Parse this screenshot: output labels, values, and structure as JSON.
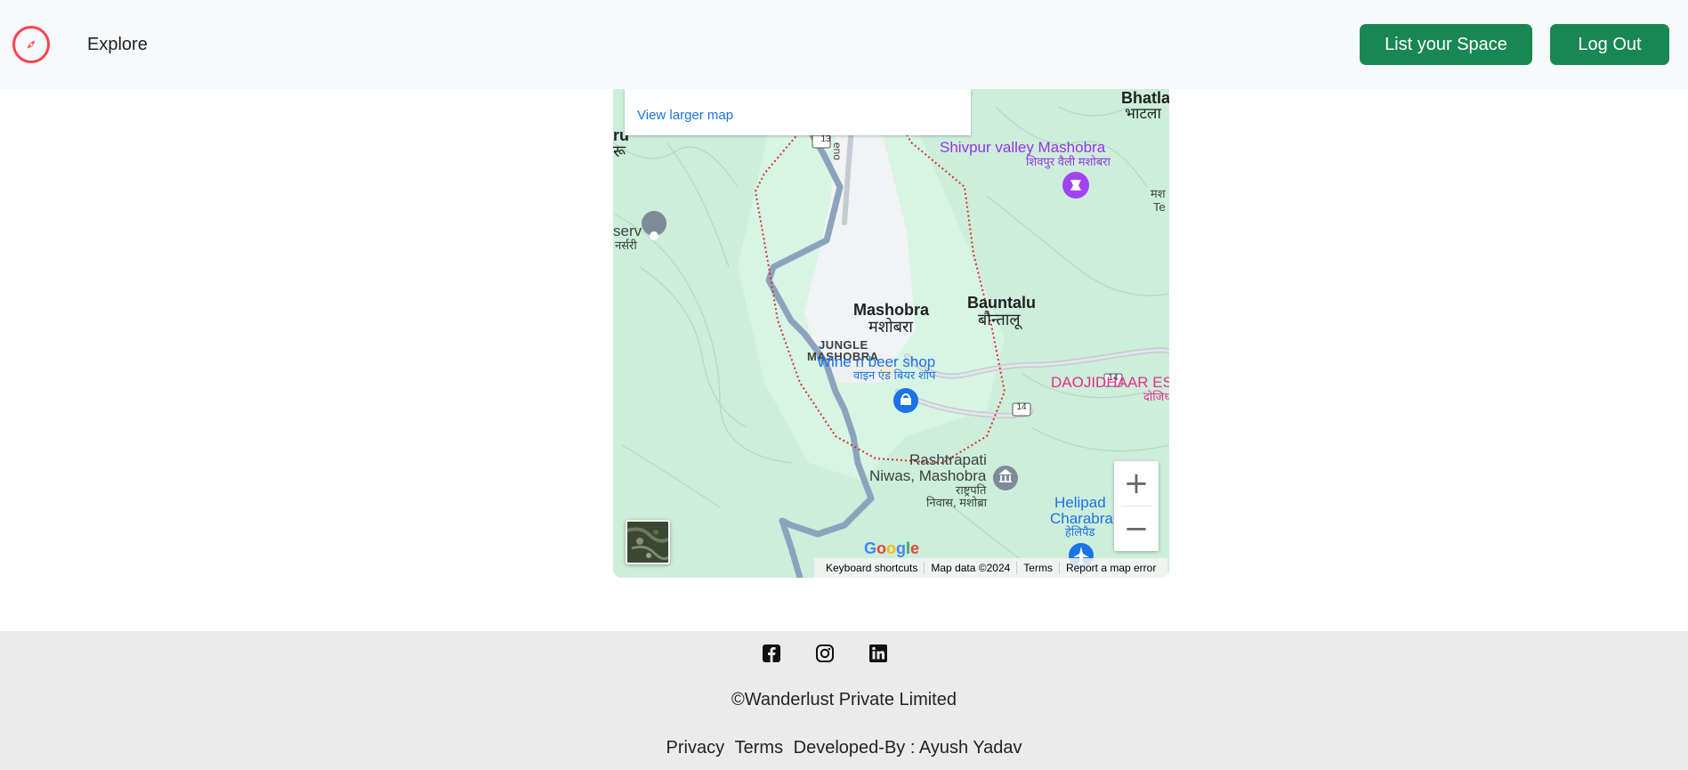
{
  "navbar": {
    "brand_icon": "compass-icon",
    "explore_label": "Explore",
    "list_space_label": "List your Space",
    "logout_label": "Log Out",
    "brand_color": "#fe424d",
    "button_color": "#198754"
  },
  "map": {
    "view_larger_label": "View larger map",
    "labels": {
      "bhatla": "Bhatla",
      "bhatla_hi": "भाटला",
      "ru": "ru",
      "ru_hi": "रू",
      "shivpur": "Shivpur valley Mashobra",
      "shivpur_hi": "शिवपुर वैली मशोबरा",
      "serv": "serv",
      "serv_hi": "नर्सरी",
      "mashobra": "Mashobra",
      "mashobra_hi": "मशोबरा",
      "bauntalu": "Bauntalu",
      "bauntalu_hi": "बौन्तालू",
      "jungle": "JUNGLE",
      "jungle2": "MASHOBRA",
      "wine": "Wine n beer shop",
      "wine_hi": "वाइन एंड बियर शॉप",
      "daojidhaar": "DAOJIDHAAR ES",
      "daojidhaar_hi": "दोजिध",
      "rashtrapati": "Rashtrapati",
      "rashtrapati2": "Niwas, Mashobra",
      "rashtrapati_hi": "राष्ट्रपति",
      "rashtrapati_hi2": "निवास, मशोब्रा",
      "helipad": "Helipad",
      "helipad2": "Charabra",
      "helipad_hi": "हेलिपैड",
      "ma_hi": "मश",
      "te": "Te",
      "road13": "13",
      "road14a": "14",
      "road14b": "14",
      "eno": "eno"
    },
    "zoom_in_label": "+",
    "zoom_out_label": "−",
    "google_logo": "Google",
    "attribution": {
      "keyboard": "Keyboard shortcuts",
      "map_data": "Map data ©2024",
      "terms": "Terms",
      "report": "Report a map error"
    }
  },
  "footer": {
    "social": [
      "facebook-icon",
      "instagram-icon",
      "linkedin-icon"
    ],
    "copyright": "©Wanderlust Private Limited",
    "privacy": "Privacy",
    "terms": "Terms",
    "developed_by": "Developed-By : Ayush Yadav"
  }
}
